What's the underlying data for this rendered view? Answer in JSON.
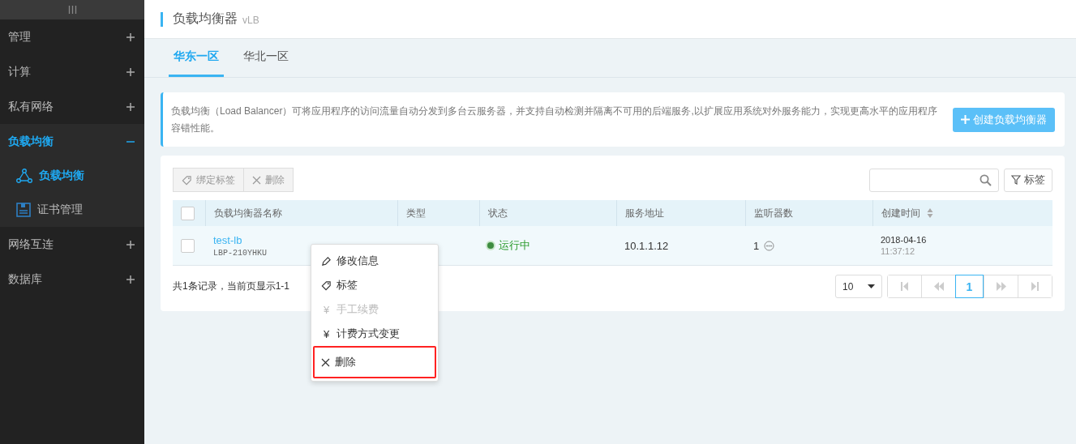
{
  "sidebar": {
    "items": [
      {
        "label": "管理",
        "expanded": false,
        "selected": false
      },
      {
        "label": "计算",
        "expanded": false,
        "selected": false
      },
      {
        "label": "私有网络",
        "expanded": false,
        "selected": false
      },
      {
        "label": "负载均衡",
        "expanded": true,
        "selected": true,
        "children": [
          {
            "kind": "network",
            "label": "负载均衡",
            "selected": true
          },
          {
            "kind": "certificate",
            "label": "证书管理",
            "selected": false
          }
        ]
      },
      {
        "label": "网络互连",
        "expanded": false,
        "selected": false
      },
      {
        "label": "数据库",
        "expanded": false,
        "selected": false
      }
    ]
  },
  "header": {
    "title": "负载均衡器",
    "subtitle": "vLB"
  },
  "tabs": [
    {
      "label": "华东一区",
      "selected": true
    },
    {
      "label": "华北一区",
      "selected": false
    }
  ],
  "notice": {
    "text": "负载均衡（Load Balancer）可将应用程序的访问流量自动分发到多台云服务器，并支持自动检测并隔离不可用的后端服务,以扩展应用系统对外服务能力，实现更高水平的应用程序容错性能。",
    "button": "创建负载均衡器"
  },
  "toolbar": {
    "buttons": [
      {
        "kind": "tag",
        "label": "绑定标签",
        "disabled": true
      },
      {
        "kind": "x",
        "label": "删除",
        "disabled": true
      }
    ],
    "filter_button": "标签"
  },
  "table": {
    "header_checked": false,
    "columns": [
      {
        "label": "负载均衡器名称",
        "sortable": false
      },
      {
        "label": "类型",
        "sortable": false
      },
      {
        "label": "状态",
        "sortable": false
      },
      {
        "label": "服务地址",
        "sortable": false
      },
      {
        "label": "监听器数",
        "sortable": false
      },
      {
        "label": "创建时间",
        "sortable": true
      }
    ],
    "rows": [
      {
        "checked": false,
        "name": "test-lb",
        "code": "LBP-210YHKU",
        "status": "运行中",
        "address": "10.1.1.12",
        "listeners": "1",
        "date": "2018-04-16",
        "time": "11:37:12"
      }
    ]
  },
  "footer": {
    "summary": "共1条记录，当前页显示1-1",
    "page_size": "10",
    "pages": [
      {
        "label": "1",
        "selected": true
      }
    ]
  },
  "context_menu": {
    "items": [
      {
        "kind": "pencil",
        "label": "修改信息",
        "disabled": false,
        "highlighted": false
      },
      {
        "kind": "tag",
        "label": "标签",
        "disabled": false,
        "highlighted": false
      },
      {
        "kind": "yen",
        "symbol": "¥",
        "label": "手工续费",
        "disabled": true,
        "highlighted": false
      },
      {
        "kind": "yen",
        "symbol": "¥",
        "label": "计费方式变更",
        "disabled": false,
        "highlighted": false
      },
      {
        "kind": "x",
        "label": "删除",
        "disabled": false,
        "highlighted": true
      }
    ]
  }
}
